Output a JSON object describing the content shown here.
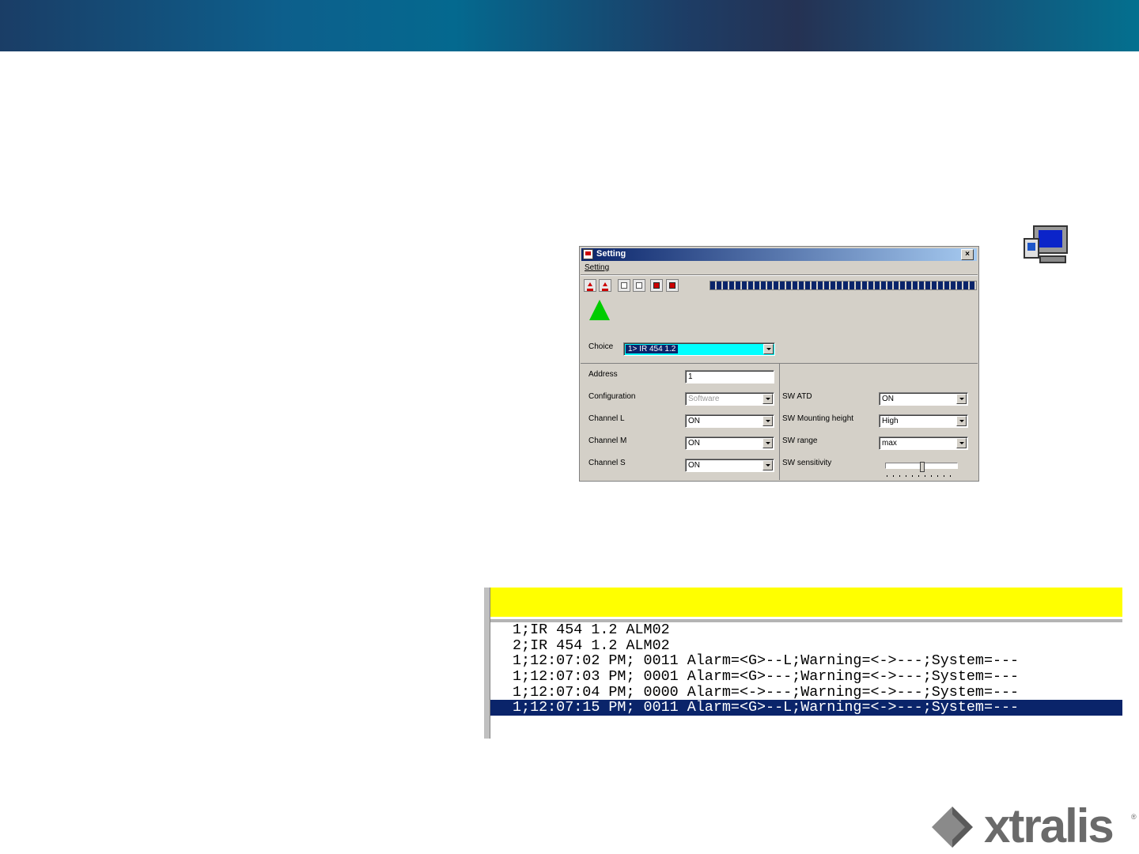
{
  "dialog": {
    "title": "Setting",
    "menu": "Setting",
    "progress_fraction": 1.0,
    "choice": {
      "label": "Choice",
      "value": "1> IR 454 1.2"
    },
    "left_fields": [
      {
        "label": "Address",
        "value": "1"
      },
      {
        "label": "Configuration",
        "value": "Software"
      },
      {
        "label": "Channel L",
        "value": "ON"
      },
      {
        "label": "Channel M",
        "value": "ON"
      },
      {
        "label": "Channel S",
        "value": "ON"
      }
    ],
    "right_fields": [
      {
        "label": "SW ATD",
        "value": "ON"
      },
      {
        "label": "SW Mounting height",
        "value": "High"
      },
      {
        "label": "SW range",
        "value": "max"
      },
      {
        "label": "SW sensitivity"
      }
    ],
    "colors": {
      "titlebar": "#0a246a",
      "choice_bg": "#00ffff",
      "status_triangle": "#00cc00"
    }
  },
  "log": {
    "header_color": "#ffff00",
    "lines": [
      "1;IR 454 1.2 ALM02",
      "2;IR 454 1.2 ALM02",
      "1;12:07:02 PM; 0011 Alarm=<G>--L;Warning=<->---;System=---",
      "1;12:07:03 PM; 0001 Alarm=<G>---;Warning=<->---;System=---",
      "1;12:07:04 PM; 0000 Alarm=<->---;Warning=<->---;System=---",
      "1;12:07:15 PM; 0011 Alarm=<G>--L;Warning=<->---;System=---"
    ],
    "selected_line": 5
  },
  "logo": {
    "text": "xtralis",
    "trademark": "®"
  }
}
